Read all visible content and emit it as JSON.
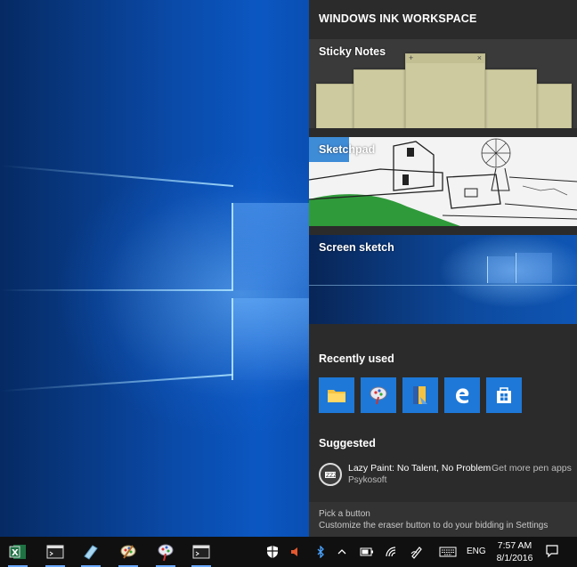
{
  "panel": {
    "title": "WINDOWS INK WORKSPACE",
    "tiles": [
      {
        "label": "Sticky Notes"
      },
      {
        "label": "Sketchpad"
      },
      {
        "label": "Screen sketch"
      }
    ],
    "recently_used": {
      "heading": "Recently used",
      "apps": [
        "file-explorer-icon",
        "paint-brush-icon",
        "sticky-file-icon",
        "edge-icon",
        "store-icon"
      ]
    },
    "suggested": {
      "heading": "Suggested",
      "app_name": "Lazy Paint: No Talent, No Problem",
      "publisher": "Psykosoft",
      "more_link": "Get more pen apps"
    },
    "tip": {
      "heading": "Pick a button",
      "text": "Customize the eraser button to do your bidding in Settings"
    }
  },
  "taskbar": {
    "apps": [
      "excel-icon",
      "console-icon",
      "notes-icon",
      "paint-icon",
      "paint3d-icon",
      "terminal-icon"
    ],
    "language": "ENG",
    "time": "7:57 AM",
    "date": "8/1/2016"
  },
  "colors": {
    "panel_bg": "#2b2b2b",
    "accent": "#1e78d7",
    "taskbar_bg": "#101010"
  }
}
